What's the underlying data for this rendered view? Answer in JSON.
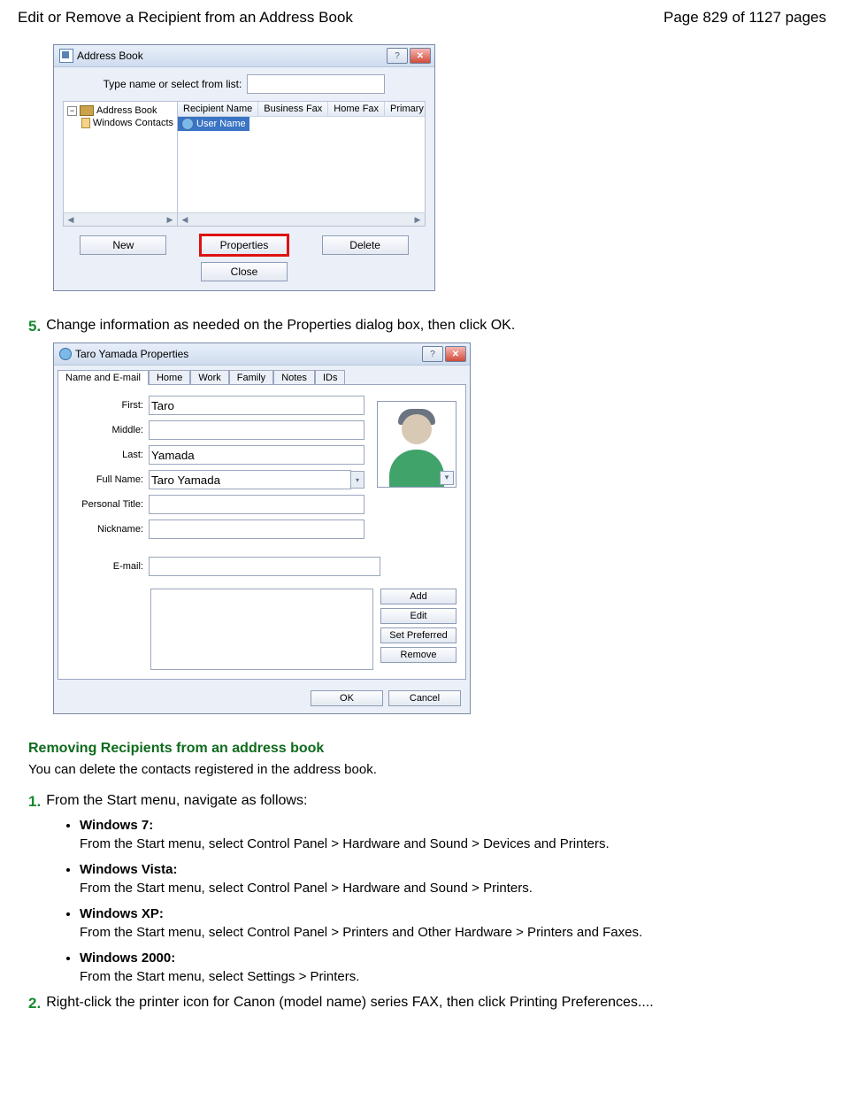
{
  "header": {
    "title": "Edit or Remove a Recipient from an Address Book",
    "page_info": "Page 829 of 1127 pages"
  },
  "address_book": {
    "window_title": "Address Book",
    "type_label": "Type name or select from list:",
    "tree": {
      "root": "Address Book",
      "child": "Windows Contacts"
    },
    "columns": {
      "c1": "Recipient Name",
      "c2": "Business Fax",
      "c3": "Home Fax",
      "c4": "Primary Fax"
    },
    "selected_item": "User Name",
    "buttons": {
      "new": "New",
      "properties": "Properties",
      "delete": "Delete",
      "close": "Close"
    }
  },
  "step5": {
    "num": "5.",
    "text": "Change information as needed on the Properties dialog box, then click OK."
  },
  "properties": {
    "window_title": "Taro Yamada Properties",
    "tabs": {
      "t0": "Name and E-mail",
      "t1": "Home",
      "t2": "Work",
      "t3": "Family",
      "t4": "Notes",
      "t5": "IDs"
    },
    "fields": {
      "first_label": "First:",
      "first_value": "Taro",
      "middle_label": "Middle:",
      "middle_value": "",
      "last_label": "Last:",
      "last_value": "Yamada",
      "fullname_label": "Full Name:",
      "fullname_value": "Taro Yamada",
      "title_label": "Personal Title:",
      "title_value": "",
      "nickname_label": "Nickname:",
      "nickname_value": "",
      "email_label": "E-mail:"
    },
    "email_buttons": {
      "add": "Add",
      "edit": "Edit",
      "setpref": "Set Preferred",
      "remove": "Remove"
    },
    "footer": {
      "ok": "OK",
      "cancel": "Cancel"
    }
  },
  "removing": {
    "heading": "Removing Recipients from an address book",
    "para": "You can delete the contacts registered in the address book."
  },
  "step1": {
    "num": "1.",
    "text": "From the Start menu, navigate as follows:"
  },
  "os": {
    "w7_label": "Windows 7:",
    "w7_text": "From the Start menu, select Control Panel > Hardware and Sound > Devices and Printers.",
    "vista_label": "Windows Vista:",
    "vista_text": "From the Start menu, select Control Panel > Hardware and Sound > Printers.",
    "xp_label": "Windows XP:",
    "xp_text": "From the Start menu, select Control Panel > Printers and Other Hardware > Printers and Faxes.",
    "w2000_label": "Windows 2000:",
    "w2000_text": "From the Start menu, select Settings > Printers."
  },
  "step2": {
    "num": "2.",
    "text": "Right-click the printer icon for Canon (model name) series FAX, then click Printing Preferences...."
  }
}
